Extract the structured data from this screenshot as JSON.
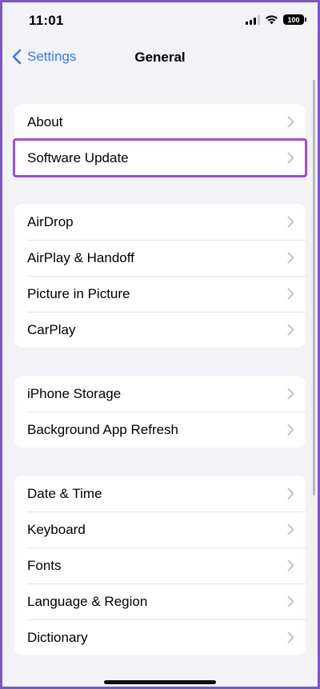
{
  "status": {
    "time": "11:01",
    "battery": "100"
  },
  "nav": {
    "back_label": "Settings",
    "title": "General"
  },
  "colors": {
    "accent": "#3478f6",
    "highlight": "#a14ae2",
    "background": "#f2f2f7"
  },
  "groups": [
    {
      "items": [
        {
          "label": "About"
        },
        {
          "label": "Software Update",
          "highlighted": true
        }
      ]
    },
    {
      "items": [
        {
          "label": "AirDrop"
        },
        {
          "label": "AirPlay & Handoff"
        },
        {
          "label": "Picture in Picture"
        },
        {
          "label": "CarPlay"
        }
      ]
    },
    {
      "items": [
        {
          "label": "iPhone Storage"
        },
        {
          "label": "Background App Refresh"
        }
      ]
    },
    {
      "items": [
        {
          "label": "Date & Time"
        },
        {
          "label": "Keyboard"
        },
        {
          "label": "Fonts"
        },
        {
          "label": "Language & Region"
        },
        {
          "label": "Dictionary"
        }
      ]
    }
  ]
}
